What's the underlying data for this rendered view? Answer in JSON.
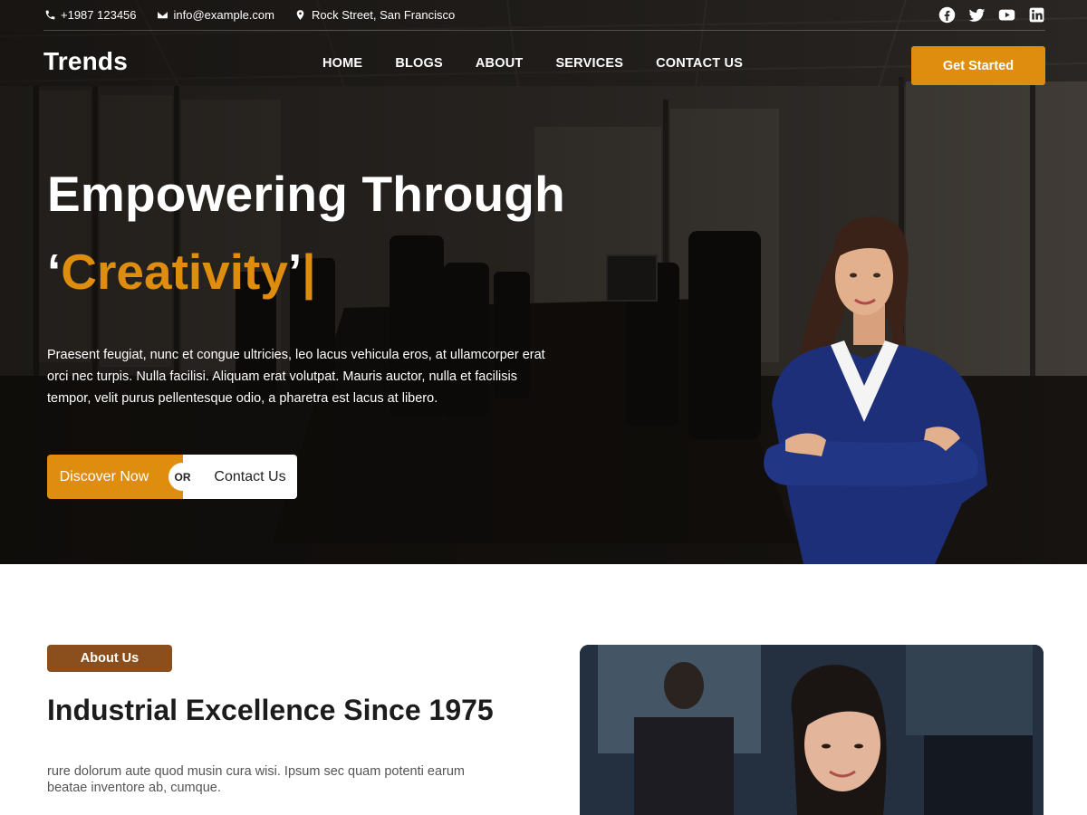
{
  "topbar": {
    "phone": "+1987 123456",
    "email": "info@example.com",
    "address": "Rock Street, San Francisco",
    "socials": [
      "facebook-icon",
      "twitter-icon",
      "youtube-icon",
      "linkedin-icon"
    ]
  },
  "header": {
    "logo": "Trends",
    "nav": [
      "HOME",
      "BLOGS",
      "ABOUT",
      "SERVICES",
      "CONTACT US"
    ],
    "cta": "Get Started"
  },
  "hero": {
    "title": "Empowering Through",
    "open_quote": "‘",
    "word": "Creativity",
    "close_quote": "’",
    "caret": "|",
    "description": "Praesent feugiat, nunc et congue ultricies, leo lacus vehicula eros, at ullamcorper erat orci nec turpis. Nulla facilisi. Aliquam erat volutpat. Mauris auctor, nulla et facilisis tempor, velit purus pellentesque odio, a pharetra est lacus at libero.",
    "discover_label": "Discover Now",
    "or_label": "OR",
    "contact_label": "Contact Us"
  },
  "about": {
    "badge": "About Us",
    "title": "Industrial Excellence Since 1975",
    "description": "rure dolorum aute quod musin cura wisi. Ipsum sec quam potenti earum beatae inventore ab, cumque."
  },
  "colors": {
    "accent": "#de8d0e",
    "badge": "#8a4f1c",
    "hero_dark": "#1f1c1a"
  }
}
